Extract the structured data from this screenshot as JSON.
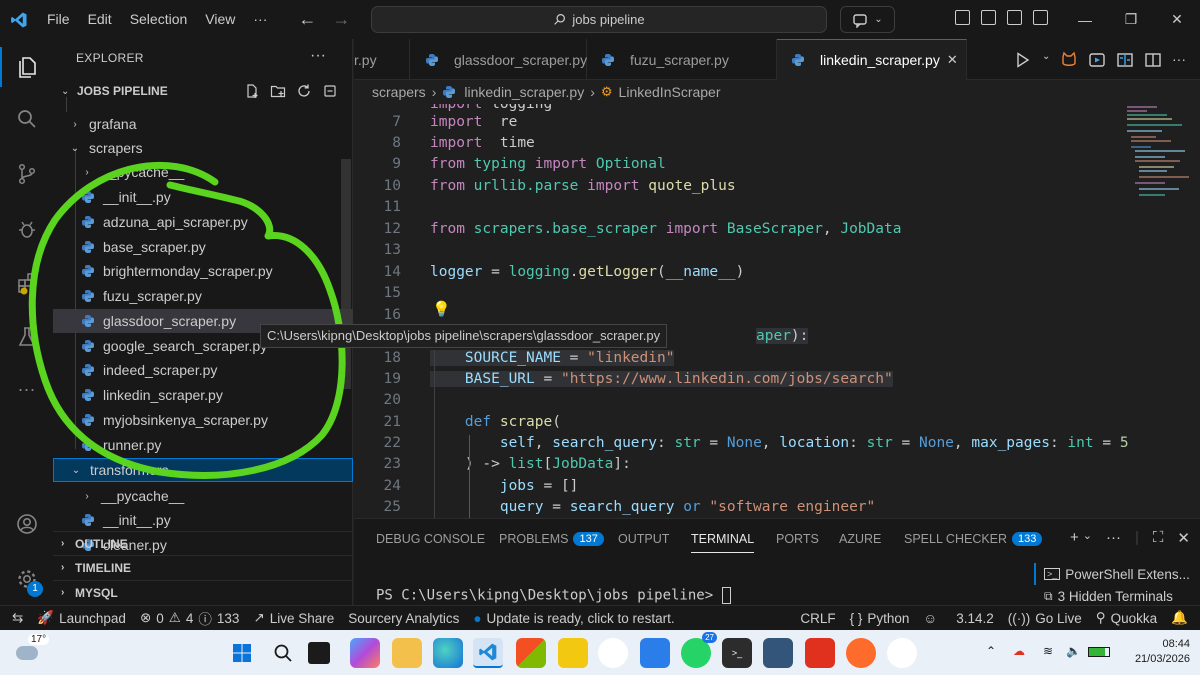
{
  "titlebar": {
    "menu": [
      "File",
      "Edit",
      "Selection",
      "View",
      "···"
    ],
    "search": "jobs pipeline"
  },
  "explorer": {
    "title": "EXPLORER",
    "more": "···",
    "project": "JOBS PIPELINE",
    "tree": [
      {
        "label": "grafana",
        "type": "folder",
        "collapsed": true
      },
      {
        "label": "scrapers",
        "type": "folder",
        "collapsed": false
      },
      {
        "label": "__pycache__",
        "type": "folder",
        "collapsed": true
      },
      {
        "label": "__init__.py",
        "type": "py"
      },
      {
        "label": "adzuna_api_scraper.py",
        "type": "py"
      },
      {
        "label": "base_scraper.py",
        "type": "py"
      },
      {
        "label": "brightermonday_scraper.py",
        "type": "py"
      },
      {
        "label": "fuzu_scraper.py",
        "type": "py"
      },
      {
        "label": "glassdoor_scraper.py",
        "type": "py"
      },
      {
        "label": "google_search_scraper.py",
        "type": "py"
      },
      {
        "label": "indeed_scraper.py",
        "type": "py"
      },
      {
        "label": "linkedin_scraper.py",
        "type": "py"
      },
      {
        "label": "myjobsinkenya_scraper.py",
        "type": "py"
      },
      {
        "label": "runner.py",
        "type": "py"
      },
      {
        "label": "transformers",
        "type": "folder",
        "collapsed": false
      },
      {
        "label": "__pycache__",
        "type": "folder",
        "collapsed": true
      },
      {
        "label": "__init__.py",
        "type": "py"
      },
      {
        "label": "cleaner.py",
        "type": "py"
      }
    ],
    "tooltip": "C:\\Users\\kipng\\Desktop\\jobs pipeline\\scrapers\\glassdoor_scraper.py",
    "sections": [
      "OUTLINE",
      "TIMELINE",
      "MYSQL"
    ]
  },
  "tabs": [
    {
      "label": "r.py",
      "active": false
    },
    {
      "label": "glassdoor_scraper.py",
      "active": false
    },
    {
      "label": "fuzu_scraper.py",
      "active": false
    },
    {
      "label": "linkedin_scraper.py",
      "active": true
    }
  ],
  "breadcrumb": [
    "scrapers",
    "linkedin_scraper.py",
    "LinkedInScraper"
  ],
  "code": [
    {
      "n": "7",
      "parts": [
        [
          "kw2",
          "import"
        ],
        [
          "",
          "  "
        ],
        [
          "",
          "re"
        ]
      ]
    },
    {
      "n": "8",
      "parts": [
        [
          "kw2",
          "import"
        ],
        [
          "",
          "  "
        ],
        [
          "",
          "time"
        ]
      ]
    },
    {
      "n": "9",
      "parts": [
        [
          "kw2",
          "from"
        ],
        [
          "",
          " "
        ],
        [
          "mod",
          "typing"
        ],
        [
          "",
          " "
        ],
        [
          "kw2",
          "import"
        ],
        [
          "",
          " "
        ],
        [
          "mod",
          "Optional"
        ]
      ]
    },
    {
      "n": "10",
      "parts": [
        [
          "kw2",
          "from"
        ],
        [
          "",
          " "
        ],
        [
          "mod",
          "urllib.parse"
        ],
        [
          "",
          " "
        ],
        [
          "kw2",
          "import"
        ],
        [
          "",
          " "
        ],
        [
          "fn",
          "quote_plus"
        ]
      ]
    },
    {
      "n": "11",
      "parts": []
    },
    {
      "n": "12",
      "parts": [
        [
          "kw2",
          "from"
        ],
        [
          "",
          " "
        ],
        [
          "mod",
          "scrapers.base_scraper"
        ],
        [
          "",
          " "
        ],
        [
          "kw2",
          "import"
        ],
        [
          "",
          " "
        ],
        [
          "mod",
          "BaseScraper"
        ],
        [
          "",
          ", "
        ],
        [
          "mod",
          "JobData"
        ]
      ]
    },
    {
      "n": "13",
      "parts": []
    },
    {
      "n": "14",
      "parts": [
        [
          "var",
          "logger"
        ],
        [
          "",
          " = "
        ],
        [
          "mod",
          "logging"
        ],
        [
          "",
          "."
        ],
        [
          "fn",
          "getLogger"
        ],
        [
          "",
          "("
        ],
        [
          "var",
          "__name__"
        ],
        [
          "",
          ")"
        ]
      ]
    },
    {
      "n": "15",
      "parts": []
    },
    {
      "n": "16",
      "parts": []
    },
    {
      "n": "17",
      "parts": [
        [
          "",
          ""
        ],
        [
          "mod",
          "aper"
        ],
        [
          "",
          "):"
        ]
      ]
    },
    {
      "n": "18",
      "parts": [
        [
          "",
          "    "
        ],
        [
          "var",
          "SOURCE_NAME"
        ],
        [
          "",
          " = "
        ],
        [
          "str",
          "\"linkedin\""
        ]
      ]
    },
    {
      "n": "19",
      "parts": [
        [
          "",
          "    "
        ],
        [
          "var",
          "BASE_URL"
        ],
        [
          "",
          " = "
        ],
        [
          "str",
          "\"https://www.linkedin.com/jobs/search\""
        ]
      ]
    },
    {
      "n": "20",
      "parts": []
    },
    {
      "n": "21",
      "parts": [
        [
          "",
          "    "
        ],
        [
          "kw",
          "def"
        ],
        [
          "",
          " "
        ],
        [
          "fn",
          "scrape"
        ],
        [
          "",
          "("
        ]
      ]
    },
    {
      "n": "22",
      "parts": [
        [
          "",
          "        "
        ],
        [
          "var",
          "self"
        ],
        [
          "",
          ", "
        ],
        [
          "var",
          "search_query"
        ],
        [
          "",
          ": "
        ],
        [
          "mod",
          "str"
        ],
        [
          "",
          " = "
        ],
        [
          "kw",
          "None"
        ],
        [
          "",
          ", "
        ],
        [
          "var",
          "location"
        ],
        [
          "",
          ": "
        ],
        [
          "mod",
          "str"
        ],
        [
          "",
          " = "
        ],
        [
          "kw",
          "None"
        ],
        [
          "",
          ", "
        ],
        [
          "var",
          "max_pages"
        ],
        [
          "",
          ": "
        ],
        [
          "mod",
          "int"
        ],
        [
          "",
          " = "
        ],
        [
          "num",
          "5"
        ]
      ]
    },
    {
      "n": "23",
      "parts": [
        [
          "",
          "    ) -> "
        ],
        [
          "mod",
          "list"
        ],
        [
          "",
          "["
        ],
        [
          "mod",
          "JobData"
        ],
        [
          "",
          "]:"
        ]
      ]
    },
    {
      "n": "24",
      "parts": [
        [
          "",
          "        "
        ],
        [
          "var",
          "jobs"
        ],
        [
          "",
          " = []"
        ]
      ]
    },
    {
      "n": "25",
      "parts": [
        [
          "",
          "        "
        ],
        [
          "var",
          "query"
        ],
        [
          "",
          " = "
        ],
        [
          "var",
          "search_query"
        ],
        [
          "",
          " "
        ],
        [
          "kw",
          "or"
        ],
        [
          "",
          " "
        ],
        [
          "str",
          "\"software engineer\""
        ]
      ]
    }
  ],
  "panel": {
    "tabs": [
      {
        "label": "DEBUG CONSOLE"
      },
      {
        "label": "PROBLEMS",
        "badge": "137"
      },
      {
        "label": "OUTPUT"
      },
      {
        "label": "TERMINAL",
        "active": true
      },
      {
        "label": "PORTS"
      },
      {
        "label": "AZURE"
      },
      {
        "label": "SPELL CHECKER",
        "badge": "133"
      }
    ],
    "prompt": "PS C:\\Users\\kipng\\Desktop\\jobs pipeline> ",
    "terminals": [
      "PowerShell Extens...",
      "3 Hidden Terminals"
    ]
  },
  "statusbar": {
    "launchpad": "Launchpad",
    "errors": "0",
    "warnings": "4",
    "infos": "133",
    "live_share": "Live Share",
    "sourcery": "Sourcery Analytics",
    "update": "Update is ready, click to restart.",
    "eol": "CRLF",
    "language": "Python",
    "version": "3.14.2",
    "go_live": "Go Live",
    "quokka": "Quokka"
  },
  "activity_badge": "1",
  "taskbar": {
    "temperature": "17°",
    "badge_whatsapp": "27",
    "time": "08:44",
    "date": "21/03/2026"
  },
  "colors": {
    "accent": "#0078d4",
    "annotation": "#5ad41e"
  }
}
